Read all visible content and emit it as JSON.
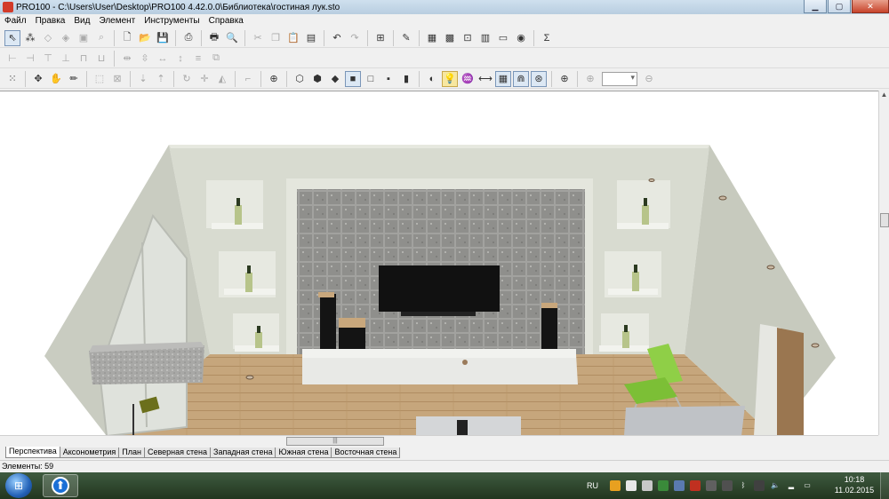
{
  "window": {
    "title": "PRO100 - C:\\Users\\User\\Desktop\\PRO100 4.42.0.0\\Библиотека\\гостиная лук.sto",
    "minimize": "▁",
    "maximize": "▢",
    "close": "✕"
  },
  "menu": [
    "Файл",
    "Правка",
    "Вид",
    "Элемент",
    "Инструменты",
    "Справка"
  ],
  "toolbar": {
    "sum_label": "Σ"
  },
  "tabs": [
    "Перспектива",
    "Аксонометрия",
    "План",
    "Северная стена",
    "Западная стена",
    "Южная стена",
    "Восточная стена"
  ],
  "status": {
    "elements": "Элементы: 59"
  },
  "taskbar": {
    "language": "RU",
    "time": "10:18",
    "date": "11.02.2015"
  },
  "colors": {
    "wall": "#d9dcd2",
    "floor": "#c8a77c",
    "tv": "#111111",
    "tile": "#9d9d9a",
    "chair": "#8fcf47"
  }
}
